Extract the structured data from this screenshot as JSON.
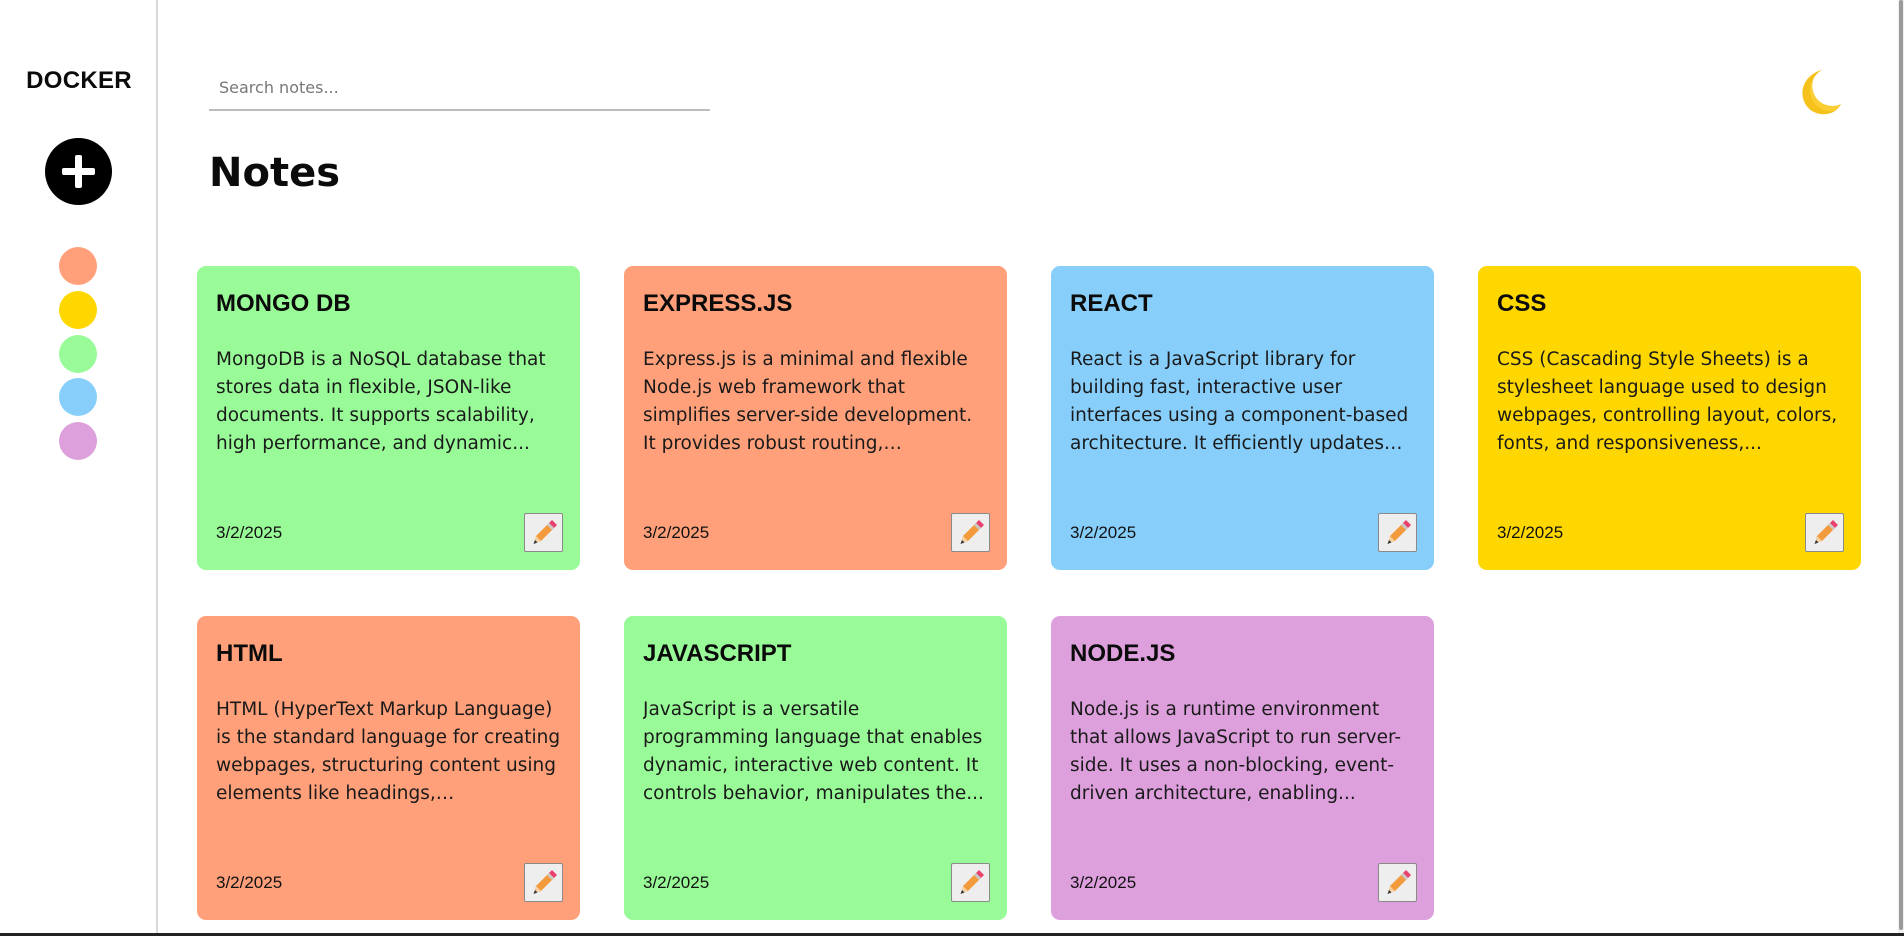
{
  "sidebar": {
    "brand": "DOCKER",
    "add_icon": "plus-icon",
    "swatches": [
      {
        "name": "salmon",
        "color": "#FFA07A"
      },
      {
        "name": "gold",
        "color": "#FFD700"
      },
      {
        "name": "light-green",
        "color": "#98FB98"
      },
      {
        "name": "light-sky-blue",
        "color": "#87CEFA"
      },
      {
        "name": "plum",
        "color": "#DDA0DD"
      }
    ]
  },
  "header": {
    "search_placeholder": "Search notes...",
    "search_value": "",
    "theme_icon": "crescent-moon-icon"
  },
  "main": {
    "title": "Notes",
    "notes": [
      {
        "title": "MONGO DB",
        "content": "MongoDB is a NoSQL database that stores data in flexible, JSON-like documents. It supports scalability, high performance, and dynamic...",
        "date": "3/2/2025",
        "color": "#98FB98",
        "edit_icon": "pencil-icon"
      },
      {
        "title": "EXPRESS.JS",
        "content": "Express.js is a minimal and flexible Node.js web framework that simplifies server-side development. It provides robust routing, middleware...",
        "date": "3/2/2025",
        "color": "#FFA07A",
        "edit_icon": "pencil-icon"
      },
      {
        "title": "REACT",
        "content": "React is a JavaScript library for building fast, interactive user interfaces using a component-based architecture. It efficiently updates th...",
        "date": "3/2/2025",
        "color": "#87CEFA",
        "edit_icon": "pencil-icon"
      },
      {
        "title": "CSS",
        "content": "CSS (Cascading Style Sheets) is a stylesheet language used to design webpages, controlling layout, colors, fonts, and responsiveness,...",
        "date": "3/2/2025",
        "color": "#FFD700",
        "edit_icon": "pencil-icon"
      },
      {
        "title": "HTML",
        "content": "HTML (HyperText Markup Language) is the standard language for creating webpages, structuring content using elements like headings, paragraphs,...",
        "date": "3/2/2025",
        "color": "#FFA07A",
        "edit_icon": "pencil-icon"
      },
      {
        "title": "JAVASCRIPT",
        "content": "JavaScript is a versatile programming language that enables dynamic, interactive web content. It controls behavior, manipulates the...",
        "date": "3/2/2025",
        "color": "#98FB98",
        "edit_icon": "pencil-icon"
      },
      {
        "title": "NODE.JS",
        "content": "Node.js is a runtime environment that allows JavaScript to run server-side. It uses a non-blocking, event-driven architecture, enabling...",
        "date": "3/2/2025",
        "color": "#DDA0DD",
        "edit_icon": "pencil-icon"
      }
    ]
  }
}
